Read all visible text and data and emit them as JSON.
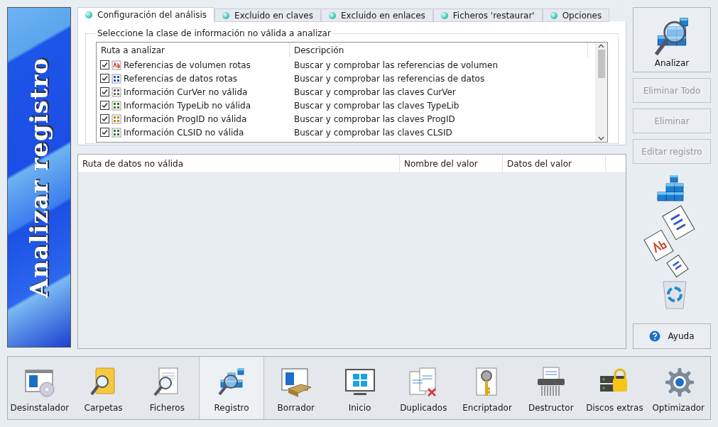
{
  "banner": {
    "title": "Analizar registro"
  },
  "tabs": [
    {
      "label": "Configuración del análisis",
      "selected": true
    },
    {
      "label": "Excluido en claves",
      "selected": false
    },
    {
      "label": "Excluido en enlaces",
      "selected": false
    },
    {
      "label": "Ficheros 'restaurar'",
      "selected": false
    },
    {
      "label": "Opciones",
      "selected": false
    }
  ],
  "scan_group": {
    "title": "Seleccione la clase de información no válida a analizar",
    "columns": [
      "Ruta a analizar",
      "Descripción"
    ],
    "rows": [
      {
        "name": "Referencias de volumen rotas",
        "description": "Buscar y comprobar las referencias de volumen",
        "checked": true,
        "kind": "text"
      },
      {
        "name": "Referencias de datos rotas",
        "description": "Buscar y comprobar las referencias de datos",
        "checked": true,
        "kind": "binary"
      },
      {
        "name": "Información CurVer no válida",
        "description": "Buscar y comprobar las claves CurVer",
        "checked": true,
        "kind": "curver"
      },
      {
        "name": "Información TypeLib no válida",
        "description": "Buscar y comprobar las claves TypeLib",
        "checked": true,
        "kind": "typelib"
      },
      {
        "name": "Información ProgID no válida",
        "description": "Buscar y comprobar las claves ProgID",
        "checked": true,
        "kind": "progid"
      },
      {
        "name": "Información CLSID no válida",
        "description": "Buscar y comprobar las claves CLSID",
        "checked": true,
        "kind": "clsid"
      }
    ]
  },
  "results": {
    "columns": [
      "Ruta de datos no válida",
      "Nombre del valor",
      "Datos del valor"
    ]
  },
  "actions": [
    {
      "label": "Analizar",
      "disabled": false,
      "kind": "main"
    },
    {
      "label": "Eliminar Todo",
      "disabled": true,
      "kind": "plain"
    },
    {
      "label": "Eliminar",
      "disabled": true,
      "kind": "plain"
    },
    {
      "label": "Editar registro",
      "disabled": true,
      "kind": "plain"
    }
  ],
  "help_button": {
    "label": "Ayuda"
  },
  "toolbar": [
    {
      "label": "Desinstalador",
      "selected": false,
      "kind": "uninstall"
    },
    {
      "label": "Carpetas",
      "selected": false,
      "kind": "folders"
    },
    {
      "label": "Ficheros",
      "selected": false,
      "kind": "files"
    },
    {
      "label": "Registro",
      "selected": true,
      "kind": "registry"
    },
    {
      "label": "Borrador",
      "selected": false,
      "kind": "eraser"
    },
    {
      "label": "Inicio",
      "selected": false,
      "kind": "startup"
    },
    {
      "label": "Duplicados",
      "selected": false,
      "kind": "duplicates"
    },
    {
      "label": "Encriptador",
      "selected": false,
      "kind": "encrypt"
    },
    {
      "label": "Destructor",
      "selected": false,
      "kind": "shredder"
    },
    {
      "label": "Discos extras",
      "selected": false,
      "kind": "disks"
    },
    {
      "label": "Optimizador",
      "selected": false,
      "kind": "optimizer"
    }
  ]
}
